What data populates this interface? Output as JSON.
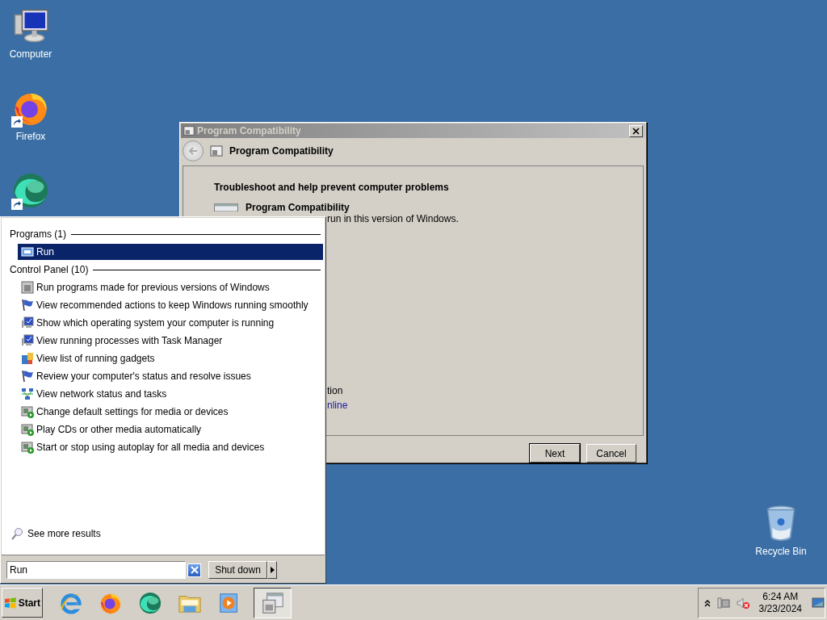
{
  "desktop_icons": [
    {
      "kind": "computer",
      "label": "Computer"
    },
    {
      "kind": "firefox",
      "label": "Firefox"
    },
    {
      "kind": "edge"
    },
    {
      "kind": "recycle",
      "label": "Recycle Bin"
    }
  ],
  "dialog": {
    "title": "Program Compatibility",
    "header": "Program Compatibility",
    "heading": "Troubleshoot and help prevent computer problems",
    "item_title": "Program Compatibility",
    "item_desc": "run in this version of Windows.",
    "fragments": [
      {
        "kind": "text",
        "text": "tion"
      },
      {
        "kind": "link",
        "text": "nline"
      }
    ],
    "buttons": [
      {
        "label": "Next",
        "default": true
      },
      {
        "label": "Cancel",
        "default": false
      }
    ]
  },
  "start_menu": {
    "groups": [
      {
        "title": "Programs (1)",
        "items": [
          {
            "kind": "run",
            "label": "Run",
            "selected": true
          }
        ]
      },
      {
        "title": "Control Panel (10)",
        "items": [
          {
            "kind": "compat",
            "label": "Run programs made for previous versions of Windows",
            "selected": false
          },
          {
            "kind": "flag",
            "label": "View recommended actions to keep Windows running smoothly",
            "selected": false
          },
          {
            "kind": "monitor",
            "label": "Show which operating system your computer is running",
            "selected": false
          },
          {
            "kind": "monitor",
            "label": "View running processes with Task Manager",
            "selected": false
          },
          {
            "kind": "gadgets",
            "label": "View list of running gadgets",
            "selected": false
          },
          {
            "kind": "flag",
            "label": "Review your computer's status and resolve issues",
            "selected": false
          },
          {
            "kind": "network",
            "label": "View network status and tasks",
            "selected": false
          },
          {
            "kind": "autoplay",
            "label": "Change default settings for media or devices",
            "selected": false
          },
          {
            "kind": "autoplay",
            "label": "Play CDs or other media automatically",
            "selected": false
          },
          {
            "kind": "autoplay",
            "label": "Start or stop using autoplay for all media and devices",
            "selected": false
          }
        ]
      }
    ],
    "see_more": "See more results",
    "search": {
      "value": "Run"
    },
    "shutdown": "Shut down"
  },
  "taskbar": {
    "start": "Start",
    "buttons": [
      {
        "kind": "ie",
        "selected": false
      },
      {
        "kind": "firefox",
        "selected": false
      },
      {
        "kind": "edge",
        "selected": false
      },
      {
        "kind": "explorer",
        "selected": false
      },
      {
        "kind": "media",
        "selected": false
      },
      {
        "kind": "window",
        "selected": true
      }
    ],
    "clock": {
      "time": "6:24 AM",
      "date": "3/23/2024"
    }
  }
}
